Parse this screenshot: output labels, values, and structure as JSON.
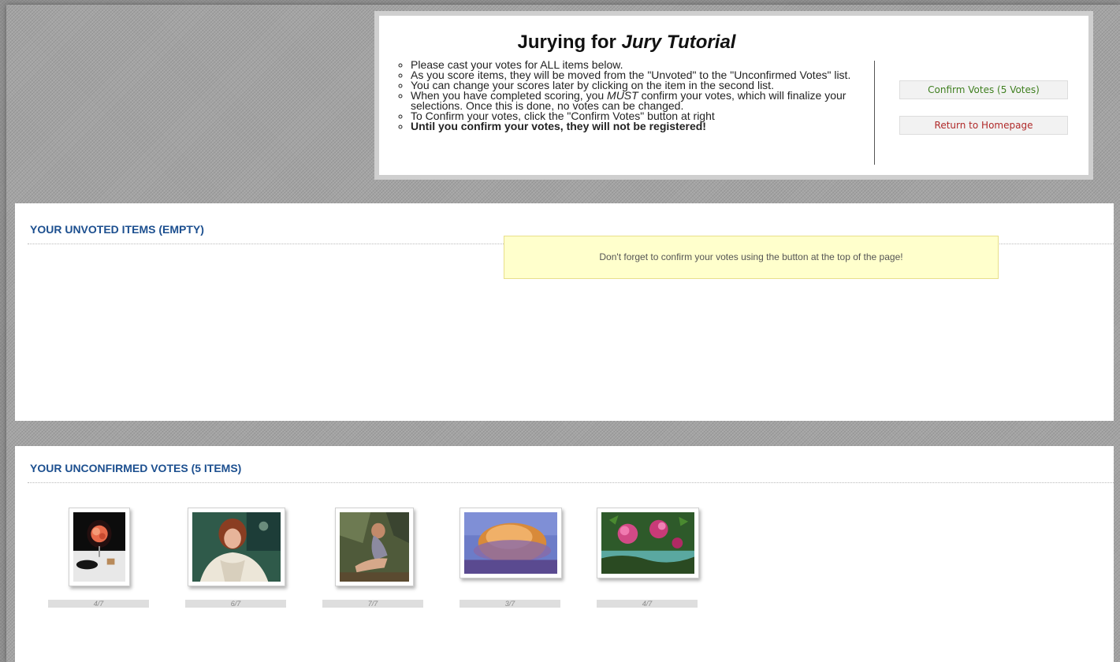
{
  "header": {
    "title_prefix": "Jurying for ",
    "title_name": "Jury Tutorial",
    "instructions": {
      "line1": "Please cast your votes for ALL items below.",
      "line2": "As you score items, they will be moved from the \"Unvoted\" to the \"Unconfirmed Votes\" list.",
      "line3": "You can change your scores later by clicking on the item in the second list.",
      "line4_a": "When you have completed scoring, you ",
      "line4_em": "MUST",
      "line4_b": " confirm your votes, which will finalize your selections. Once this is done, no votes can be changed.",
      "line5": "To Confirm your votes, click the \"Confirm Votes\" button at right",
      "line6": "Until you confirm your votes, they will not be registered!"
    },
    "confirm_button": "Confirm Votes (5 Votes)",
    "return_button": "Return to Homepage"
  },
  "unvoted": {
    "title": "YOUR UNVOTED ITEMS (EMPTY)",
    "notice": "Don't forget to confirm your votes using the button at the top of the page!"
  },
  "unconfirmed": {
    "title": "YOUR UNCONFIRMED VOTES (5 ITEMS)",
    "items": [
      {
        "score": "4/7",
        "subject": "rose-in-glass"
      },
      {
        "score": "6/7",
        "subject": "woman-portrait"
      },
      {
        "score": "7/7",
        "subject": "seated-figure"
      },
      {
        "score": "3/7",
        "subject": "misty-landscape"
      },
      {
        "score": "4/7",
        "subject": "pink-flowers"
      }
    ]
  },
  "colors": {
    "section_title": "#1c4f8f",
    "confirm_text": "#3f7f1f",
    "return_text": "#b02a2a",
    "notice_bg": "#ffffcc"
  }
}
